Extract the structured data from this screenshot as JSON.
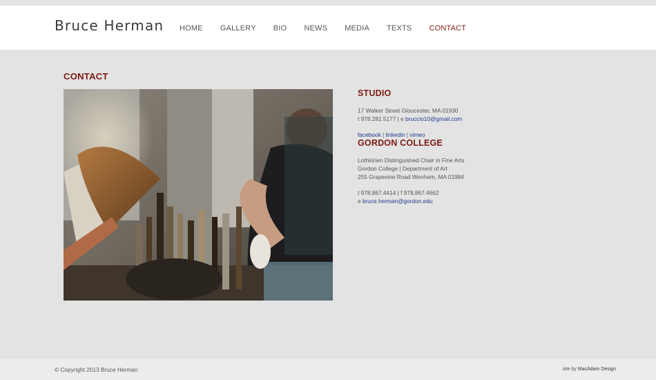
{
  "site": {
    "logo": "Bruce Herman"
  },
  "nav": {
    "items": [
      {
        "label": "HOME"
      },
      {
        "label": "GALLERY"
      },
      {
        "label": "BIO"
      },
      {
        "label": "NEWS"
      },
      {
        "label": "MEDIA"
      },
      {
        "label": "TEXTS"
      },
      {
        "label": "CONTACT"
      }
    ],
    "active": "CONTACT"
  },
  "page": {
    "title": "CONTACT"
  },
  "studio": {
    "title": "STUDIO",
    "address": "17 Walker Street Gloucester, MA 01930",
    "phone_prefix": "t 978.281.5177 | e ",
    "email": "bruccio10@gmail.com",
    "social": [
      "facebook",
      "linkedin",
      "vimeo"
    ],
    "separator": " | "
  },
  "gordon": {
    "title": "GORDON COLLEGE",
    "position": "Lothlórien Distinguished Chair in Fine Arts",
    "department": "Gordon College | Department of Art",
    "address": "255 Grapevine Road Wenham, MA 01984",
    "phone_fax": "t 978.867.4414 | f 978.867.4662",
    "email_prefix": "e ",
    "email": "bruce.herman@gordon.edu"
  },
  "footer": {
    "copyright": "© Copyright 2013 Bruce Herman",
    "credit_prefix": "site by ",
    "credit_name": "MacAdam Design"
  },
  "colors": {
    "accent": "#7a1a12",
    "link": "#1f3c8c",
    "background": "#e3e3e3"
  }
}
